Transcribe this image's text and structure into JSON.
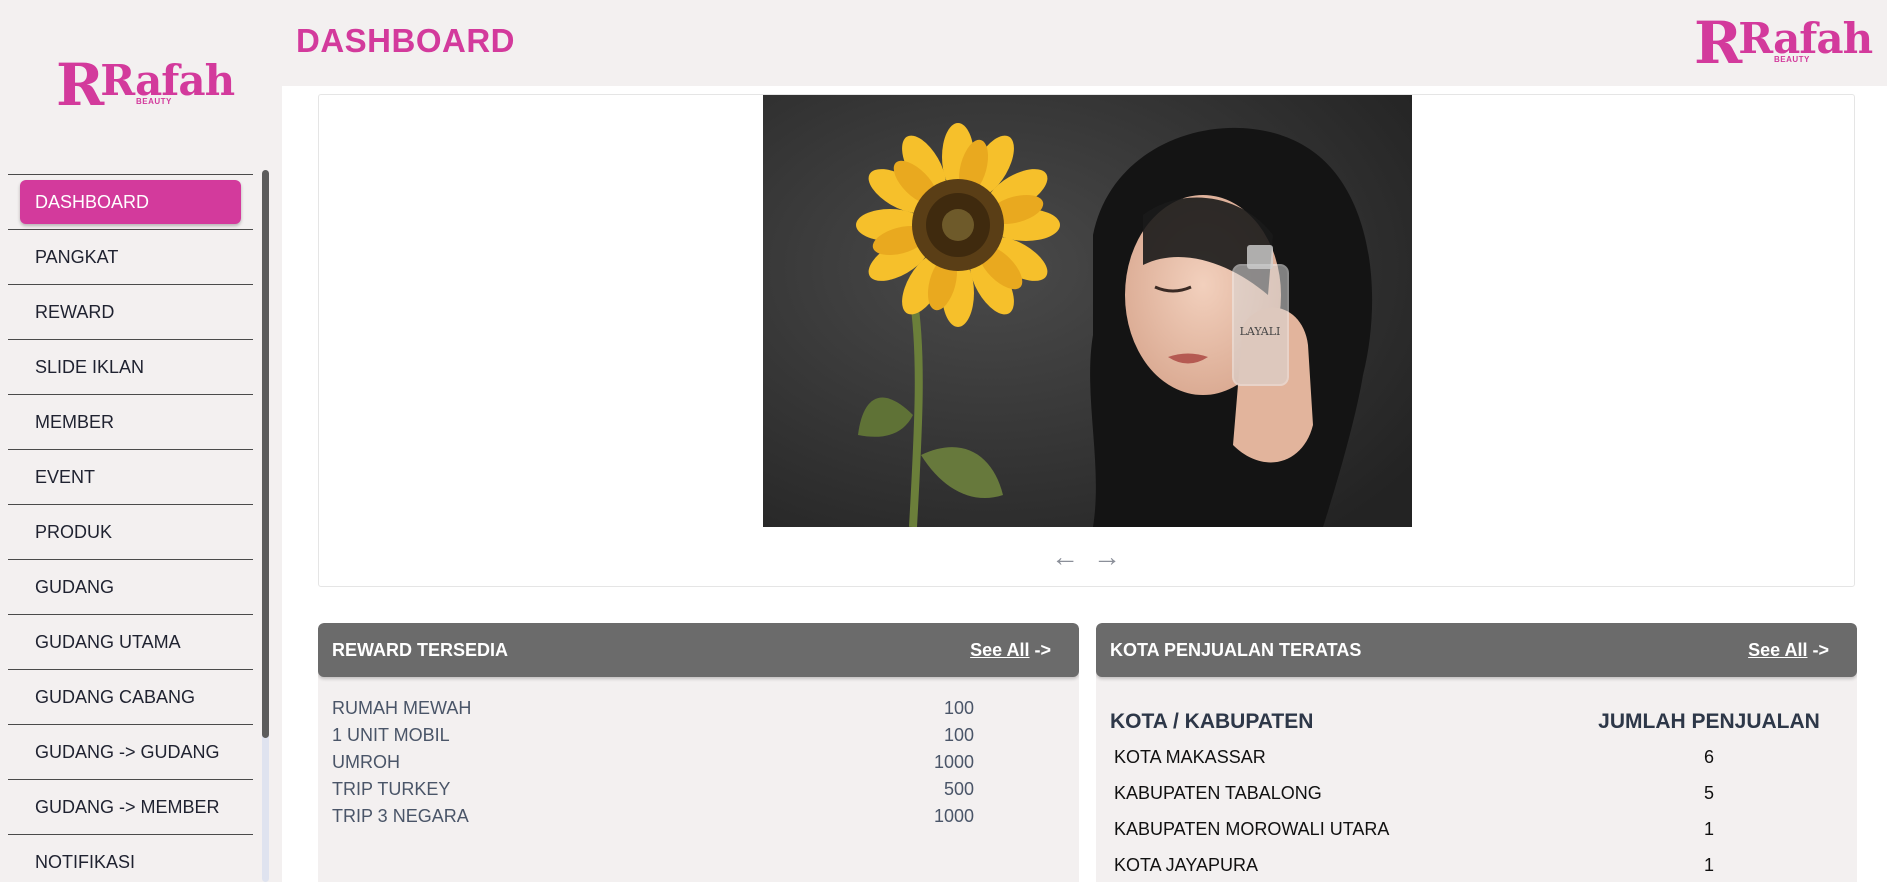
{
  "brand": {
    "logo_letter": "R",
    "logo_word": "Rafah",
    "logo_sub": "BEAUTY",
    "accent": "#d33a9c"
  },
  "header": {
    "title": "DASHBOARD"
  },
  "sidebar": {
    "items": [
      {
        "label": "DASHBOARD"
      },
      {
        "label": "PANGKAT"
      },
      {
        "label": "REWARD"
      },
      {
        "label": "SLIDE IKLAN"
      },
      {
        "label": "MEMBER"
      },
      {
        "label": "EVENT"
      },
      {
        "label": "PRODUK"
      },
      {
        "label": "GUDANG"
      },
      {
        "label": "GUDANG UTAMA"
      },
      {
        "label": "GUDANG CABANG"
      },
      {
        "label": "GUDANG -> GUDANG"
      },
      {
        "label": "GUDANG -> MEMBER"
      },
      {
        "label": "NOTIFIKASI"
      }
    ]
  },
  "slider": {
    "prev_icon": "←",
    "next_icon": "→",
    "perfume_label": "LAYALI"
  },
  "reward": {
    "title": "REWARD TERSEDIA",
    "see_all": "See All",
    "see_all_arrow": " ->",
    "items": [
      {
        "name": "RUMAH MEWAH",
        "value": "100"
      },
      {
        "name": "1 UNIT MOBIL",
        "value": "100"
      },
      {
        "name": "UMROH",
        "value": "1000"
      },
      {
        "name": "TRIP TURKEY",
        "value": "500"
      },
      {
        "name": "TRIP 3 NEGARA",
        "value": "1000"
      }
    ]
  },
  "kota": {
    "title": "KOTA PENJUALAN TERATAS",
    "see_all": "See All",
    "see_all_arrow": " ->",
    "col_city": "KOTA / KABUPATEN",
    "col_sales": "JUMLAH PENJUALAN",
    "rows": [
      {
        "city": "KOTA MAKASSAR",
        "sales": "6"
      },
      {
        "city": "KABUPATEN TABALONG",
        "sales": "5"
      },
      {
        "city": "KABUPATEN MOROWALI UTARA",
        "sales": "1"
      },
      {
        "city": "KOTA JAYAPURA",
        "sales": "1"
      }
    ]
  }
}
